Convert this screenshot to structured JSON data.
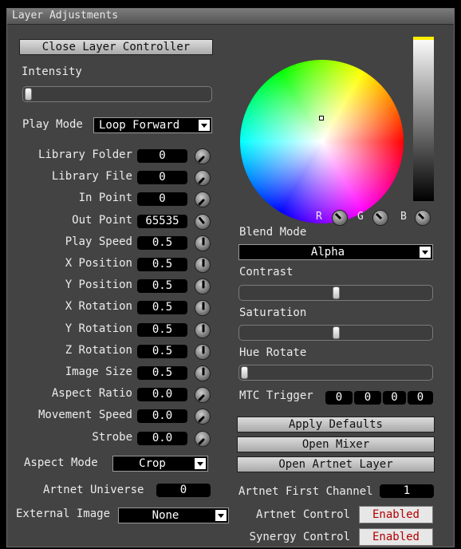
{
  "window": {
    "title": "Layer Adjustments"
  },
  "close_button": "Close Layer Controller",
  "intensity": {
    "label": "Intensity",
    "value": 0
  },
  "play_mode": {
    "label": "Play Mode",
    "value": "Loop Forward"
  },
  "params": [
    {
      "label": "Library Folder",
      "value": "0"
    },
    {
      "label": "Library File",
      "value": "0"
    },
    {
      "label": "In Point",
      "value": "0"
    },
    {
      "label": "Out Point",
      "value": "65535"
    },
    {
      "label": "Play Speed",
      "value": "0.5"
    },
    {
      "label": "X Position",
      "value": "0.5"
    },
    {
      "label": "Y Position",
      "value": "0.5"
    },
    {
      "label": "X Rotation",
      "value": "0.5"
    },
    {
      "label": "Y Rotation",
      "value": "0.5"
    },
    {
      "label": "Z Rotation",
      "value": "0.5"
    },
    {
      "label": "Image Size",
      "value": "0.5"
    },
    {
      "label": "Aspect Ratio",
      "value": "0.0"
    },
    {
      "label": "Movement Speed",
      "value": "0.0"
    },
    {
      "label": "Strobe",
      "value": "0.0"
    }
  ],
  "aspect_mode": {
    "label": "Aspect Mode",
    "value": "Crop"
  },
  "artnet_universe": {
    "label": "Artnet Universe",
    "value": "0"
  },
  "external_image": {
    "label": "External Image",
    "value": "None"
  },
  "color": {
    "rgb_labels": [
      "R",
      "G",
      "B"
    ],
    "brightness_marker_color": "#ffee00"
  },
  "blend_mode": {
    "label": "Blend Mode",
    "value": "Alpha"
  },
  "contrast": {
    "label": "Contrast",
    "value": 0.5
  },
  "saturation": {
    "label": "Saturation",
    "value": 0.5
  },
  "hue_rotate": {
    "label": "Hue Rotate",
    "value": 0
  },
  "mtc_trigger": {
    "label": "MTC Trigger",
    "values": [
      "0",
      "0",
      "0",
      "0"
    ]
  },
  "actions": {
    "apply_defaults": "Apply Defaults",
    "open_mixer": "Open Mixer",
    "open_artnet_layer": "Open Artnet Layer"
  },
  "artnet_first_channel": {
    "label": "Artnet First Channel",
    "value": "1"
  },
  "artnet_control": {
    "label": "Artnet Control",
    "value": "Enabled"
  },
  "synergy_control": {
    "label": "Synergy Control",
    "value": "Enabled"
  },
  "colors": {
    "enabled_text": "#b30000",
    "panel_bg": "#434343"
  }
}
